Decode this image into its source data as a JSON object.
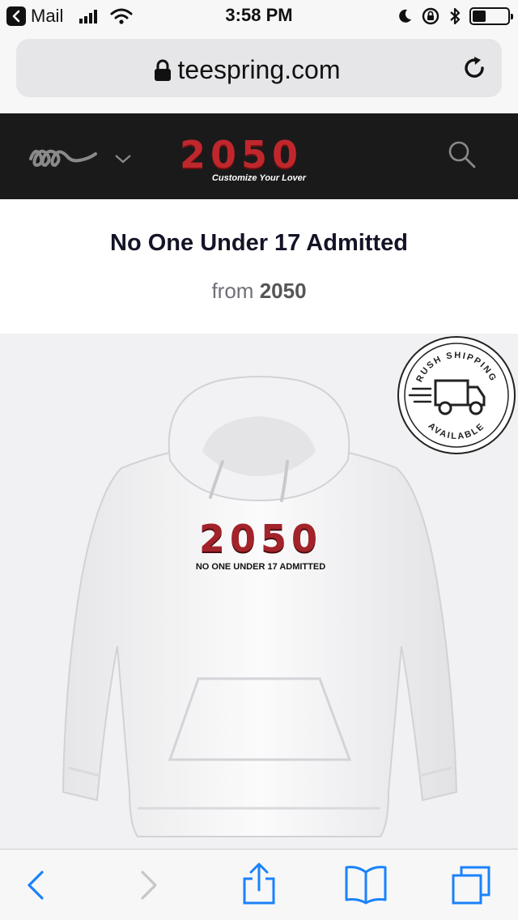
{
  "status_bar": {
    "back_app": "Mail",
    "time": "3:58 PM",
    "battery_level": 0.38
  },
  "browser": {
    "url": "teespring.com"
  },
  "site_header": {
    "brand_name": "2050",
    "tagline": "Customize Your Lover"
  },
  "product": {
    "title": "No One Under 17 Admitted",
    "from_prefix": "from",
    "store_name": "2050",
    "print_logo": "2050",
    "print_subtitle": "NO ONE UNDER 17 ADMITTED",
    "badge_top": "RUSH SHIPPING",
    "badge_bottom": "AVAILABLE"
  },
  "colors": {
    "accent": "#c0272d",
    "ios_blue": "#1a82fb",
    "header_bg": "#1a1a1a"
  },
  "icons": {
    "statusbar": [
      "back-arrow-icon",
      "signal-icon",
      "wifi-icon",
      "moon-icon",
      "rotation-lock-icon",
      "bluetooth-icon",
      "battery-icon"
    ],
    "toolbar": [
      "back-icon",
      "forward-icon",
      "share-icon",
      "bookmarks-icon",
      "tabs-icon"
    ]
  }
}
